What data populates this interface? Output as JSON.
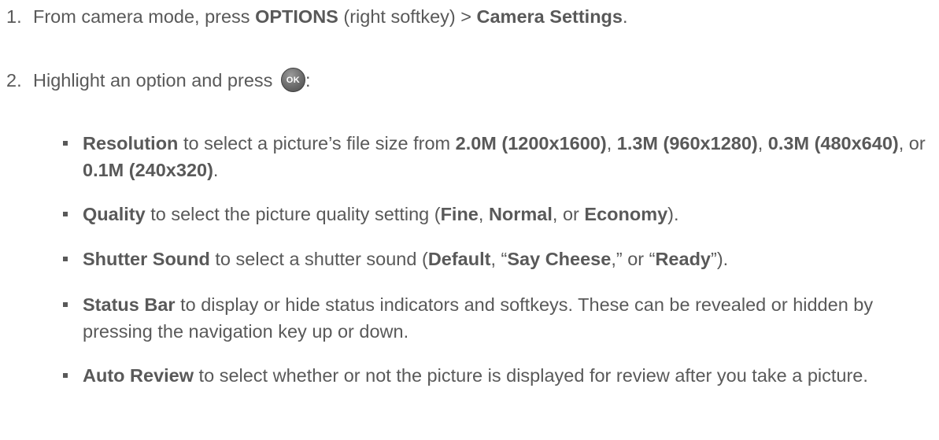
{
  "steps": [
    {
      "number": "1.",
      "text_before": "From camera mode, press ",
      "bold1": "OPTIONS",
      "text_mid": " (right softkey) > ",
      "bold2": "Camera Settings",
      "text_after": "."
    },
    {
      "number": "2.",
      "text_before": "Highlight an option and press ",
      "ok_label": "OK",
      "text_after": ":"
    }
  ],
  "bullets": [
    {
      "parts": [
        {
          "b": "Resolution"
        },
        {
          "t": " to select a picture’s file size from "
        },
        {
          "b": "2.0M (1200x1600)"
        },
        {
          "t": ", "
        },
        {
          "b": "1.3M (960x1280)"
        },
        {
          "t": ", "
        },
        {
          "b": "0.3M (480x640)"
        },
        {
          "t": ", or "
        },
        {
          "b": "0.1M (240x320)"
        },
        {
          "t": "."
        }
      ]
    },
    {
      "parts": [
        {
          "b": "Quality"
        },
        {
          "t": " to select the picture quality setting ("
        },
        {
          "b": "Fine"
        },
        {
          "t": ", "
        },
        {
          "b": "Normal"
        },
        {
          "t": ", or "
        },
        {
          "b": "Economy"
        },
        {
          "t": ")."
        }
      ]
    },
    {
      "parts": [
        {
          "b": "Shutter Sound"
        },
        {
          "t": " to select a shutter sound ("
        },
        {
          "b": "Default"
        },
        {
          "t": ", “"
        },
        {
          "b": "Say Cheese"
        },
        {
          "t": ",” or “"
        },
        {
          "b": "Ready"
        },
        {
          "t": "”)."
        }
      ]
    },
    {
      "parts": [
        {
          "b": "Status Bar"
        },
        {
          "t": " to display or hide status indicators and softkeys. These can be revealed or hidden by pressing the navigation key up or down."
        }
      ]
    },
    {
      "parts": [
        {
          "b": "Auto Review"
        },
        {
          "t": " to select whether or not the picture is displayed for review after you take a picture."
        }
      ]
    }
  ]
}
